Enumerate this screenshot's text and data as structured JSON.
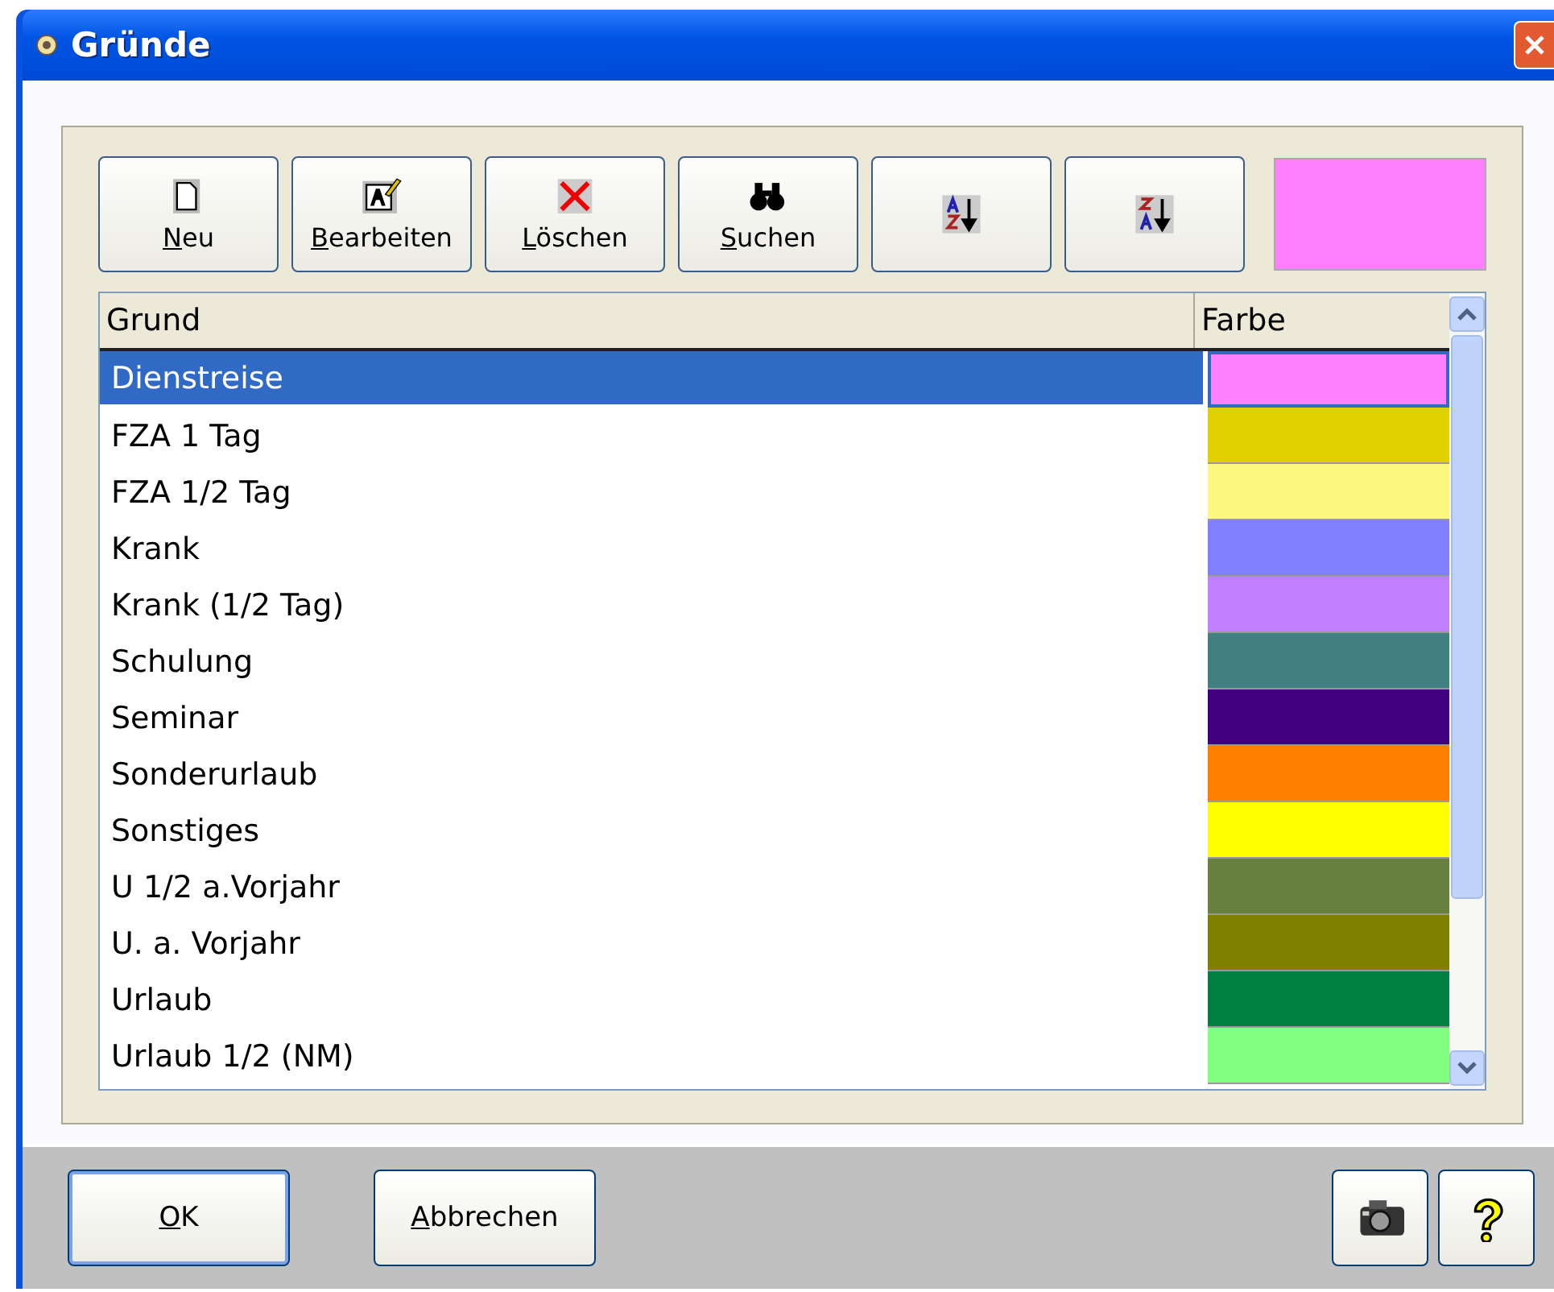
{
  "window": {
    "title": "Gründe"
  },
  "toolbar": [
    {
      "kind": "new",
      "label": "Neu",
      "mnemonic": true
    },
    {
      "kind": "edit",
      "label": "Bearbeiten",
      "mnemonic": true
    },
    {
      "kind": "delete",
      "label": "Löschen",
      "mnemonic": true
    },
    {
      "kind": "find",
      "label": "Suchen",
      "mnemonic": true
    },
    {
      "kind": "sort-asc"
    },
    {
      "kind": "sort-desc"
    }
  ],
  "swatch": {
    "color": "#ff80ff"
  },
  "table": {
    "columns": [
      "Grund",
      "Farbe"
    ],
    "rows": [
      {
        "reason": "Dienstreise",
        "color": "#ff80ff",
        "selected": true
      },
      {
        "reason": "FZA 1  Tag",
        "color": "#e0d000",
        "selected": false
      },
      {
        "reason": "FZA 1/2 Tag",
        "color": "#fff880",
        "selected": false
      },
      {
        "reason": "Krank",
        "color": "#8080ff",
        "selected": false
      },
      {
        "reason": "Krank (1/2 Tag)",
        "color": "#c080ff",
        "selected": false
      },
      {
        "reason": "Schulung",
        "color": "#408080",
        "selected": false
      },
      {
        "reason": "Seminar",
        "color": "#400080",
        "selected": false
      },
      {
        "reason": "Sonderurlaub",
        "color": "#ff8000",
        "selected": false
      },
      {
        "reason": "Sonstiges",
        "color": "#ffff00",
        "selected": false
      },
      {
        "reason": "U 1/2 a.Vorjahr",
        "color": "#688040",
        "selected": false
      },
      {
        "reason": "U. a. Vorjahr",
        "color": "#808000",
        "selected": false
      },
      {
        "reason": "Urlaub",
        "color": "#008040",
        "selected": false
      },
      {
        "reason": "Urlaub 1/2 (NM)",
        "color": "#80ff80",
        "selected": false
      }
    ]
  },
  "buttons": [
    {
      "label": "OK",
      "mnemonic": true,
      "default": true
    },
    {
      "label": "Abbrechen",
      "mnemonic": true,
      "default": false
    }
  ],
  "tool_buttons": [
    {
      "kind": "camera"
    },
    {
      "kind": "help"
    }
  ]
}
